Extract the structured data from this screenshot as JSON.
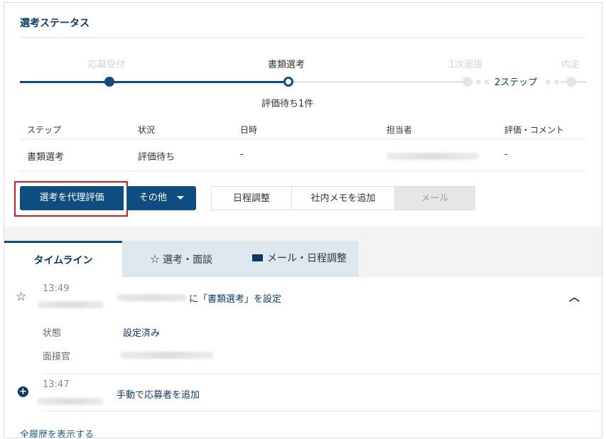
{
  "status_section": {
    "title": "選考ステータス",
    "stages": [
      {
        "label": "応募受付",
        "state": "done"
      },
      {
        "label": "書類選考",
        "state": "current"
      },
      {
        "label": "1次面接",
        "state": "future"
      },
      {
        "label": "内定",
        "state": "future"
      }
    ],
    "skip_label": "2ステップ",
    "eval_note": "評価待ち1件",
    "table": {
      "headers": [
        "ステップ",
        "状況",
        "日時",
        "担当者",
        "評価・コメント"
      ],
      "row": {
        "step": "書類選考",
        "status": "評価待ち",
        "datetime": "-",
        "comment": "-"
      }
    },
    "buttons": {
      "proxy_eval": "選考を代理評価",
      "other": "その他",
      "schedule": "日程調整",
      "memo": "社内メモを追加",
      "mail": "メール"
    }
  },
  "tabs": {
    "timeline": "タイムライン",
    "selection": "選考・面談",
    "mail_schedule": "メール・日程調整"
  },
  "timeline": [
    {
      "time": "13:49",
      "text": "に「書類選考」を設定",
      "details": [
        {
          "label": "状態",
          "value": "設定済み"
        },
        {
          "label": "面接官",
          "value": ""
        }
      ]
    },
    {
      "time": "13:47",
      "text": "手動で応募者を追加"
    }
  ],
  "show_all": "全履歴を表示する",
  "colors": {
    "primary": "#0f4c7f",
    "highlight": "#e0181e",
    "tab_inactive": "#dde7ee"
  }
}
